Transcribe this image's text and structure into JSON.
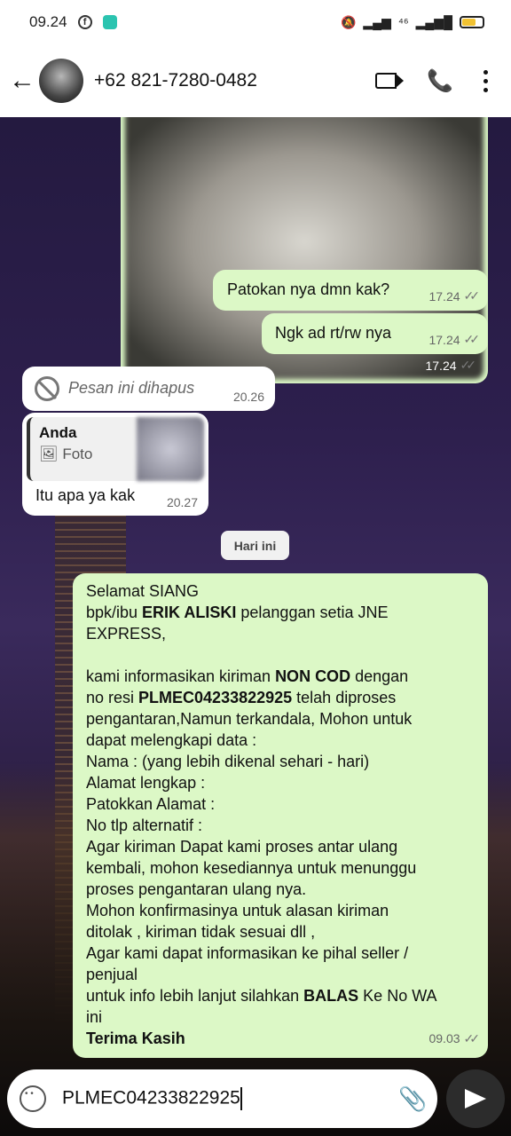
{
  "status": {
    "time": "09.24",
    "network": "⁴⁶",
    "icons": [
      "facebook-icon",
      "chat-app-icon",
      "mute-bell-icon",
      "signal-icon",
      "battery-icon"
    ]
  },
  "header": {
    "contact": "+62 821-7280-0482",
    "icons": [
      "back-arrow-icon",
      "label-icon",
      "add-call-icon",
      "more-vert-icon"
    ]
  },
  "messages": {
    "image_time": "17.24",
    "m1": {
      "text": "Patokan nya dmn kak?",
      "time": "17.24"
    },
    "m2": {
      "text": "Ngk ad rt/rw nya",
      "time": "17.24"
    },
    "deleted": {
      "text": "Pesan ini dihapus",
      "time": "20.26"
    },
    "reply": {
      "quote_author": "Anda",
      "quote_type": "Foto",
      "text": "Itu apa ya kak",
      "time": "20.27"
    },
    "day_separator": "Hari ini",
    "long": {
      "l1": "Selamat SIANG",
      "l2a": " bpk/ibu ",
      "l2b": "ERIK ALISKI",
      "l2c": " pelanggan setia JNE",
      "l3": "EXPRESS,",
      "l5a": "kami informasikan kiriman ",
      "l5b": "NON COD",
      "l5c": " dengan",
      "l6a": "no resi ",
      "l6b": "PLMEC04233822925",
      "l6c": " telah diproses",
      "l7": "pengantaran,Namun terkandala, Mohon untuk",
      "l8": "dapat melengkapi data :",
      "l9": "Nama : (yang lebih dikenal sehari - hari)",
      "l10": "Alamat  lengkap :",
      "l11": "Patokkan Alamat :",
      "l12": "No tlp alternatif :",
      "l13": "Agar kiriman Dapat kami proses antar ulang",
      "l14": "kembali, mohon kesediannya untuk menunggu",
      "l15": "proses pengantaran ulang nya.",
      "l16": "Mohon konfirmasinya untuk alasan kiriman",
      "l17": "ditolak , kiriman tidak sesuai dll ,",
      "l18": "Agar kami dapat informasikan ke pihal seller /",
      "l19": "penjual",
      "l20a": "untuk info lebih lanjut silahkan ",
      "l20b": "BALAS",
      "l20c": " Ke No WA",
      "l21": "ini",
      "l22": "Terima Kasih",
      "time": "09.03"
    }
  },
  "composer": {
    "value": "PLMEC04233822925"
  },
  "colors": {
    "outgoing": "#dcf8c6",
    "incoming": "#ffffff",
    "send": "#2c2c2c"
  }
}
